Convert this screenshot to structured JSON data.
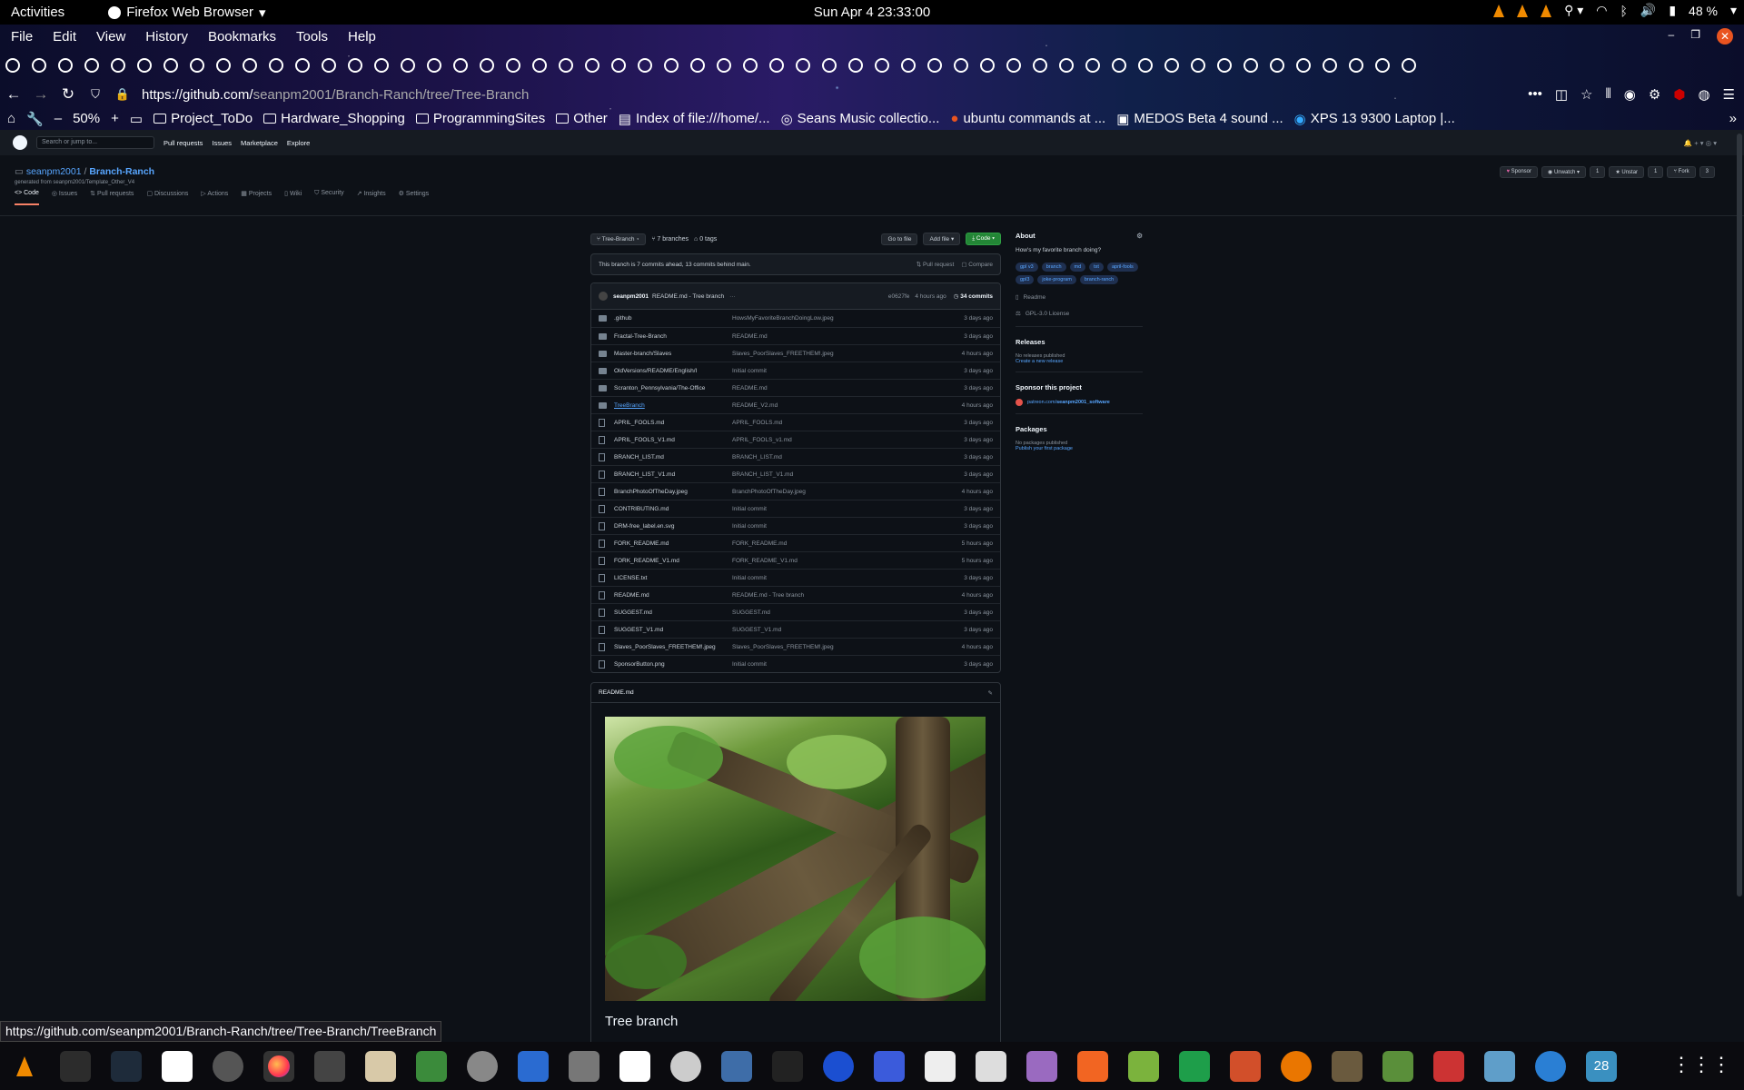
{
  "system": {
    "activities": "Activities",
    "app_name": "Firefox Web Browser",
    "clock": "Sun Apr 4  23:33:00",
    "battery": "48 %"
  },
  "browser": {
    "menu": [
      "File",
      "Edit",
      "View",
      "History",
      "Bookmarks",
      "Tools",
      "Help"
    ],
    "url_prefix": "https://github.com/",
    "url_rest": "seanpm2001/Branch-Ranch/tree/Tree-Branch",
    "zoom": "50%",
    "bookmarks": [
      "Project_ToDo",
      "Hardware_Shopping",
      "ProgrammingSites",
      "Other",
      "Index of file:///home/...",
      "Seans Music collectio...",
      "ubuntu commands at ...",
      "MEDOS Beta 4 sound ...",
      "XPS 13 9300 Laptop |..."
    ],
    "status_link": "https://github.com/seanpm2001/Branch-Ranch/tree/Tree-Branch/TreeBranch"
  },
  "github": {
    "search_placeholder": "Search or jump to...",
    "nav": [
      "Pull requests",
      "Issues",
      "Marketplace",
      "Explore"
    ],
    "owner": "seanpm2001",
    "sep": "/",
    "repo": "Branch-Ranch",
    "generated": "generated from seanpm2001/Template_Other_V4",
    "tabs": [
      "Code",
      "Issues",
      "Pull requests",
      "Discussions",
      "Actions",
      "Projects",
      "Wiki",
      "Security",
      "Insights",
      "Settings"
    ],
    "actions": [
      "Sponsor",
      "Unwatch ▾",
      "1",
      "Unstar",
      "1",
      "Fork",
      "3"
    ],
    "branch": "Tree-Branch",
    "branches": "7 branches",
    "tags": "0 tags",
    "go_to_file": "Go to file",
    "add_file": "Add file ▾",
    "code": "Code ▾",
    "ahead_text": "This branch is 7 commits ahead, 13 commits behind main.",
    "pull_request": "Pull request",
    "compare": "Compare",
    "commit_author": "seanpm2001",
    "commit_msg": "README.md - Tree branch",
    "commit_dots": "···",
    "commit_hash": "e0627fe",
    "commit_age": "4 hours ago",
    "commit_count": "34 commits",
    "files": [
      {
        "name": ".github",
        "msg": "HowsMyFavoriteBranchDoingLow.jpeg",
        "age": "3 days ago",
        "dir": true
      },
      {
        "name": "Fractal-Tree-Branch",
        "msg": "README.md",
        "age": "3 days ago",
        "dir": true
      },
      {
        "name": "Master-branch/Slaves",
        "msg": "Slaves_PoorSlaves_FREETHEM!.jpeg",
        "age": "4 hours ago",
        "dir": true
      },
      {
        "name": "OldVersions/README/English/I",
        "msg": "Initial commit",
        "age": "3 days ago",
        "dir": true
      },
      {
        "name": "Scranton_Pennsylvania/The-Office",
        "msg": "README.md",
        "age": "3 days ago",
        "dir": true
      },
      {
        "name": "TreeBranch",
        "msg": "README_V2.md",
        "age": "4 hours ago",
        "dir": true
      },
      {
        "name": "APRIL_FOOLS.md",
        "msg": "APRIL_FOOLS.md",
        "age": "3 days ago",
        "dir": false
      },
      {
        "name": "APRIL_FOOLS_V1.md",
        "msg": "APRIL_FOOLS_v1.md",
        "age": "3 days ago",
        "dir": false
      },
      {
        "name": "BRANCH_LIST.md",
        "msg": "BRANCH_LIST.md",
        "age": "3 days ago",
        "dir": false
      },
      {
        "name": "BRANCH_LIST_V1.md",
        "msg": "BRANCH_LIST_V1.md",
        "age": "3 days ago",
        "dir": false
      },
      {
        "name": "BranchPhotoOfTheDay.jpeg",
        "msg": "BranchPhotoOfTheDay.jpeg",
        "age": "4 hours ago",
        "dir": false
      },
      {
        "name": "CONTRIBUTING.md",
        "msg": "Initial commit",
        "age": "3 days ago",
        "dir": false
      },
      {
        "name": "DRM-free_label.en.svg",
        "msg": "Initial commit",
        "age": "3 days ago",
        "dir": false
      },
      {
        "name": "FORK_README.md",
        "msg": "FORK_README.md",
        "age": "5 hours ago",
        "dir": false
      },
      {
        "name": "FORK_README_V1.md",
        "msg": "FORK_README_V1.md",
        "age": "5 hours ago",
        "dir": false
      },
      {
        "name": "LICENSE.txt",
        "msg": "Initial commit",
        "age": "3 days ago",
        "dir": false
      },
      {
        "name": "README.md",
        "msg": "README.md - Tree branch",
        "age": "4 hours ago",
        "dir": false
      },
      {
        "name": "SUGGEST.md",
        "msg": "SUGGEST.md",
        "age": "3 days ago",
        "dir": false
      },
      {
        "name": "SUGGEST_V1.md",
        "msg": "SUGGEST_V1.md",
        "age": "3 days ago",
        "dir": false
      },
      {
        "name": "Slaves_PoorSlaves_FREETHEM!.jpeg",
        "msg": "Slaves_PoorSlaves_FREETHEM!.jpeg",
        "age": "4 hours ago",
        "dir": false
      },
      {
        "name": "SponsorButton.png",
        "msg": "Initial commit",
        "age": "3 days ago",
        "dir": false
      }
    ],
    "readme_label": "README.md",
    "readme_title": "Tree branch",
    "about_title": "About",
    "about_desc": "How's my favorite branch doing?",
    "topics": [
      "gpl v3",
      "branch",
      "md",
      "txt",
      "april-fools",
      "gpl3",
      "joke-program",
      "branch-ranch"
    ],
    "readme_link": "Readme",
    "license": "GPL-3.0 License",
    "releases_title": "Releases",
    "no_releases": "No releases published",
    "create_release": "Create a new release",
    "sponsor_title": "Sponsor this project",
    "sponsor_link_prefix": "patreon.com/",
    "sponsor_link_user": "seanpm2001_software",
    "packages_title": "Packages",
    "no_packages": "No packages published",
    "publish_package": "Publish your first package"
  },
  "taskbar": {
    "calendar_day": "28"
  },
  "colors": {
    "accent_link": "#58a6ff",
    "green_button": "#238636",
    "tab_underline": "#f78166"
  }
}
